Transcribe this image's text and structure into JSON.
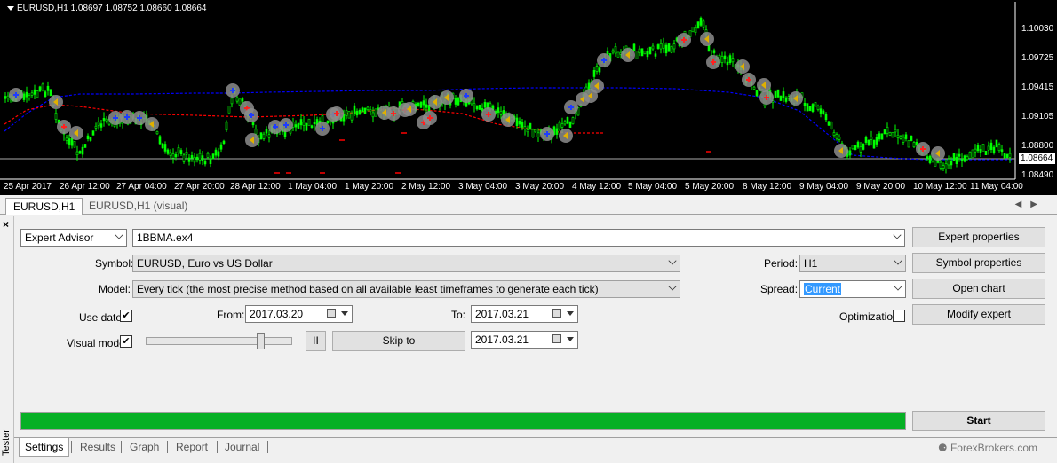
{
  "chart": {
    "header": "EURUSD,H1  1.08697 1.08752 1.08660 1.08664",
    "current_price": "1.08664",
    "price_labels": [
      "1.10030",
      "1.09725",
      "1.09415",
      "1.09105",
      "1.08800",
      "1.08490"
    ],
    "date_labels": [
      "25 Apr 2017",
      "26 Apr 12:00",
      "27 Apr 04:00",
      "27 Apr 20:00",
      "28 Apr 12:00",
      "1 May 04:00",
      "1 May 20:00",
      "2 May 12:00",
      "3 May 04:00",
      "3 May 20:00",
      "4 May 12:00",
      "5 May 04:00",
      "5 May 20:00",
      "8 May 12:00",
      "9 May 04:00",
      "9 May 20:00",
      "10 May 12:00",
      "11 May 04:00"
    ],
    "colors": {
      "background": "#000000",
      "candles": "#00ff00",
      "ma_blue": "#0000ff",
      "ma_red": "#ff0000",
      "axis": "#ffffff"
    }
  },
  "chart_tabs": [
    "EURUSD,H1",
    "EURUSD,H1 (visual)"
  ],
  "tester": {
    "side_close": "×",
    "side_label": "Tester",
    "type_select": "Expert Advisor",
    "expert_file": "1BBMA.ex4",
    "symbol_label": "Symbol:",
    "symbol_value": "EURUSD, Euro vs US Dollar",
    "model_label": "Model:",
    "model_value": "Every tick (the most precise method based on all available least timeframes to generate each tick)",
    "use_date_label": "Use date",
    "use_date_checked": "✔",
    "from_label": "From:",
    "from_value": "2017.03.20",
    "to_label": "To:",
    "to_value": "2017.03.21",
    "visual_mode_label": "Visual mode",
    "visual_mode_checked": "✔",
    "pause_label": "II",
    "skip_to_label": "Skip to",
    "skip_to_value": "2017.03.21",
    "period_label": "Period:",
    "period_value": "H1",
    "spread_label": "Spread:",
    "spread_value": "Current",
    "optimization_label": "Optimization",
    "buttons": {
      "expert_properties": "Expert properties",
      "symbol_properties": "Symbol properties",
      "open_chart": "Open chart",
      "modify_expert": "Modify expert",
      "start": "Start"
    },
    "progress_percent": 100,
    "visual_speed_fraction": 0.8
  },
  "bottom_tabs": [
    "Settings",
    "Results",
    "Graph",
    "Report",
    "Journal"
  ],
  "watermark": "ForexBrokers.com"
}
